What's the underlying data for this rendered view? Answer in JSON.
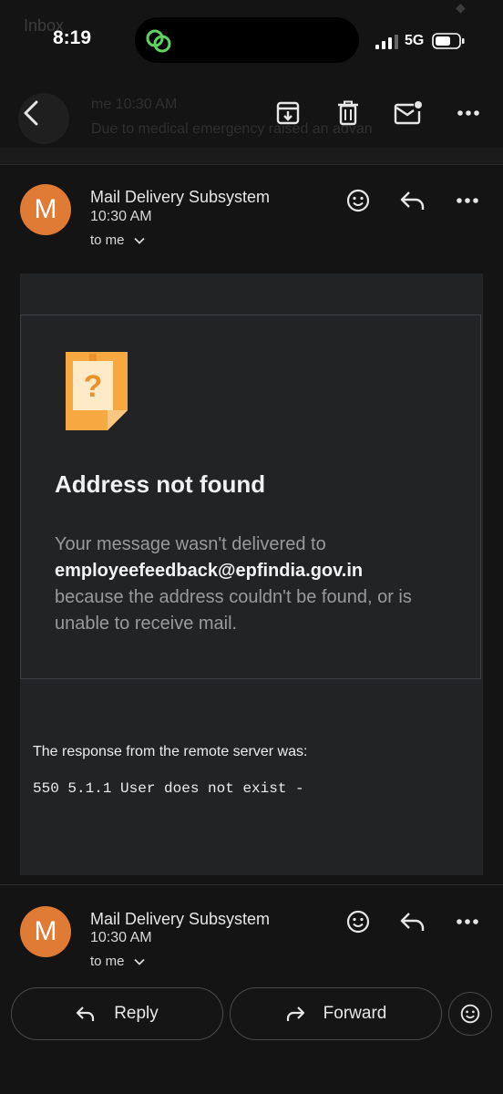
{
  "status_bar": {
    "time": "8:19",
    "network": "5G"
  },
  "faded_header": {
    "inbox_label": "Inbox",
    "from": "me  10:30 AM",
    "snippet": "Due to medical emergency raised an advan"
  },
  "messages": [
    {
      "avatar_letter": "M",
      "sender": "Mail Delivery Subsystem",
      "time": "10:30 AM",
      "recipient": "to me"
    },
    {
      "avatar_letter": "M",
      "sender": "Mail Delivery Subsystem",
      "time": "10:30 AM",
      "recipient": "to me"
    }
  ],
  "bounce": {
    "title": "Address not found",
    "text_before": "Your message wasn't delivered to",
    "address": "employeefeedback@epfindia.gov.in",
    "text_after": "because the address couldn't be found, or is unable to receive mail.",
    "response_label": "The response from the remote server was:",
    "response_code": "550 5.1.1 User does not exist -"
  },
  "actions": {
    "reply": "Reply",
    "forward": "Forward"
  },
  "icons": {
    "back": "back-arrow-icon",
    "archive": "archive-icon",
    "delete": "trash-icon",
    "mark_unread": "mail-unread-icon",
    "more": "more-horizontal-icon",
    "emoji": "emoji-icon",
    "reply": "reply-icon",
    "forward": "forward-icon"
  },
  "colors": {
    "avatar": "#e07b35",
    "background": "#141414",
    "panel": "#222325",
    "note_icon": "#f5a940"
  }
}
